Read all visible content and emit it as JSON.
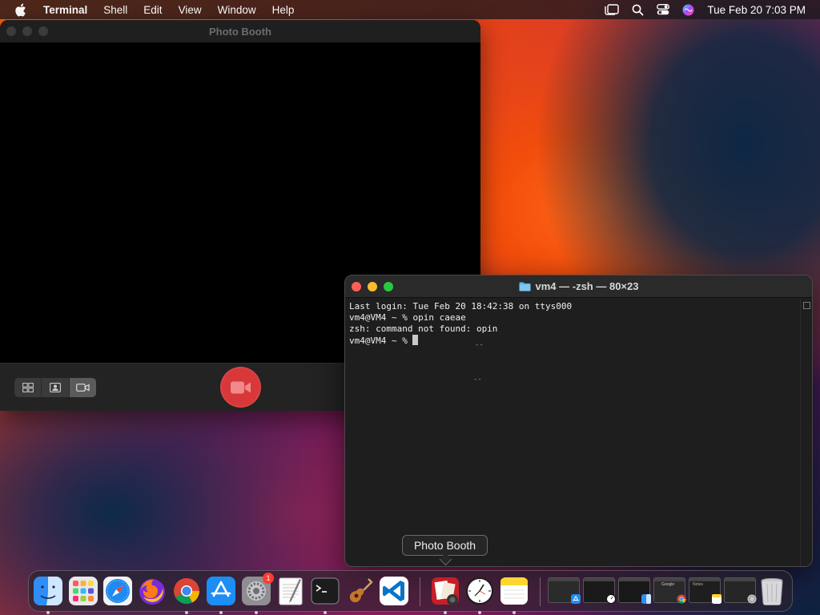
{
  "menubar": {
    "app_name": "Terminal",
    "items": [
      "Shell",
      "Edit",
      "View",
      "Window",
      "Help"
    ],
    "clock": "Tue Feb 20  7:03 PM"
  },
  "photo_booth": {
    "title": "Photo Booth"
  },
  "terminal": {
    "title": "vm4 — -zsh — 80×23",
    "lines": [
      "Last login: Tue Feb 20 18:42:38 on ttys000",
      "vm4@VM4 ~ % opin caeae",
      "zsh: command not found: opin",
      "vm4@VM4 ~ % "
    ]
  },
  "tooltip": {
    "label": "Photo Booth"
  },
  "dock": {
    "settings_badge": "1",
    "notes_title": "Notes",
    "chrome_window_label": "Google"
  },
  "colors": {
    "record_red": "#d8383a",
    "close_red": "#ff5f57",
    "minimize_yellow": "#febc2e",
    "zoom_green": "#28c840"
  }
}
